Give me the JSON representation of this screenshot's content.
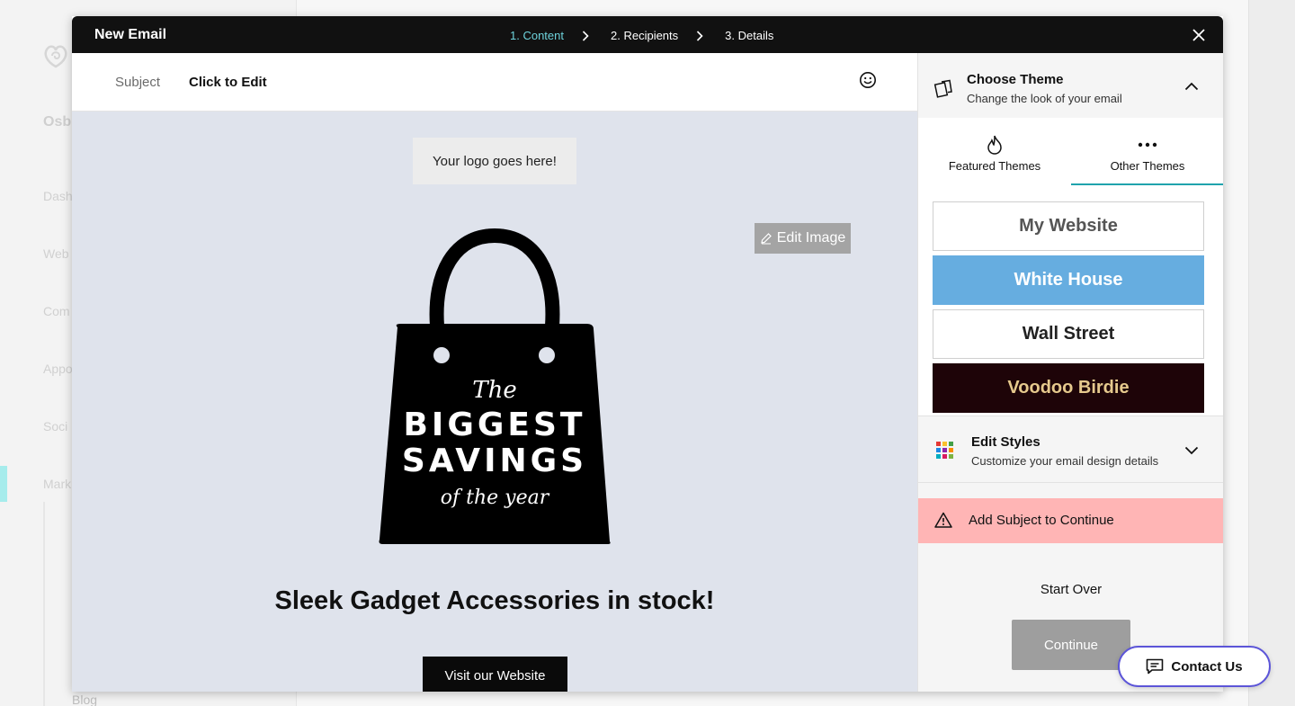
{
  "background": {
    "org_title": "Osb",
    "nav_items": [
      "Dash",
      "Web",
      "Com",
      "Appo",
      "Soci",
      "Mark"
    ],
    "blog_label": "Blog"
  },
  "modal": {
    "title": "New Email",
    "steps": [
      "1. Content",
      "2. Recipients",
      "3. Details"
    ],
    "active_step": 0,
    "close_icon": "close-icon"
  },
  "subject": {
    "label": "Subject",
    "value": "Click to Edit",
    "emoji_icon": "smiley-icon"
  },
  "canvas": {
    "logo_placeholder": "Your logo goes here!",
    "edit_image_label": "Edit Image",
    "bag_text": {
      "line1": "The",
      "line2": "BIGGEST",
      "line3": "SAVINGS",
      "line4": "of the year"
    },
    "headline": "Sleek Gadget Accessories in stock!",
    "cta_label": "Visit our Website"
  },
  "panel": {
    "choose_theme": {
      "title": "Choose Theme",
      "subtitle": "Change the look of your email"
    },
    "tabs": [
      {
        "label": "Featured Themes",
        "icon": "flame-icon"
      },
      {
        "label": "Other Themes",
        "icon": "more-dots-icon",
        "selected": true
      }
    ],
    "themes": [
      {
        "label": "My Website",
        "bg": "#ffffff",
        "fg": "#555555"
      },
      {
        "label": "White House",
        "bg": "#66ade0",
        "fg": "#ffffff"
      },
      {
        "label": "Wall Street",
        "bg": "#ffffff",
        "fg": "#222222"
      },
      {
        "label": "Voodoo Birdie",
        "bg": "#1e0408",
        "fg": "#e6c98d"
      }
    ],
    "edit_styles": {
      "title": "Edit Styles",
      "subtitle": "Customize your email design details"
    },
    "warning": "Add Subject to Continue",
    "start_over": "Start Over",
    "continue": "Continue"
  },
  "contact_us": "Contact Us",
  "colors": {
    "accent_teal": "#6ed3dc",
    "warning_bg": "#ffb5b5",
    "contact_border": "#5c55d8"
  }
}
